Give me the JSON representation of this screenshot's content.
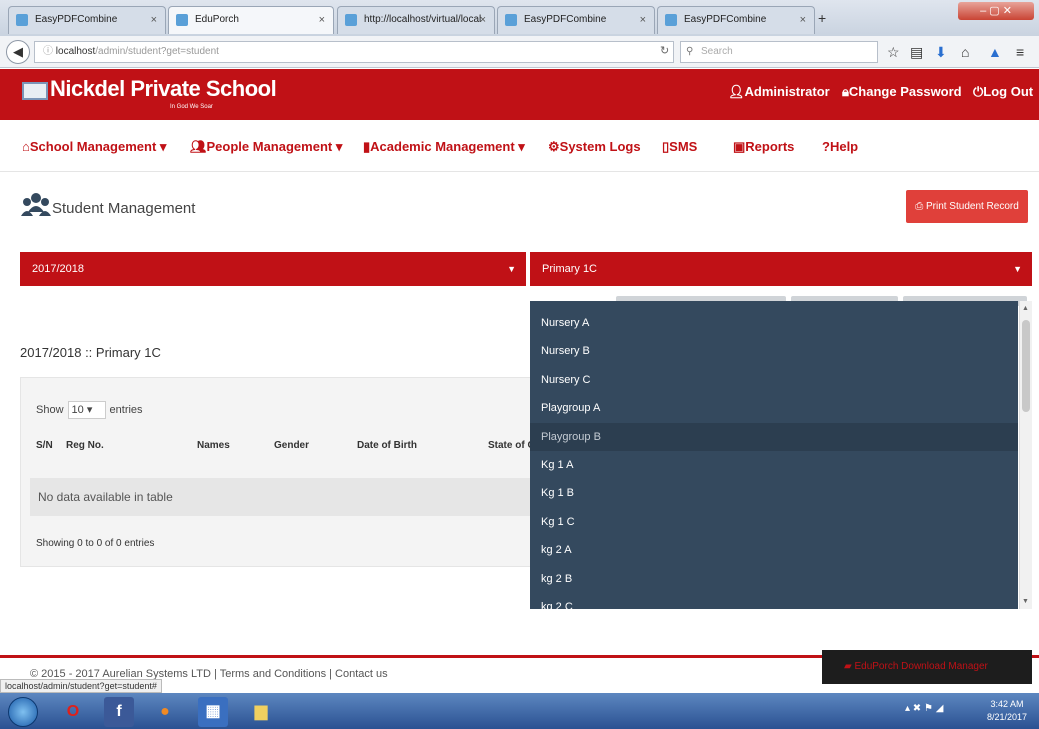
{
  "browser": {
    "tabs": [
      {
        "label": "EasyPDFCombine",
        "active": false
      },
      {
        "label": "EduPorch",
        "active": true
      },
      {
        "label": "http://localhost/virtual/local",
        "active": false
      },
      {
        "label": "EasyPDFCombine",
        "active": false
      },
      {
        "label": "EasyPDFCombine",
        "active": false
      }
    ],
    "new_tab_symbol": "+",
    "url_host": "localhost",
    "url_path": "/admin/student?get=student",
    "search_placeholder": "Search"
  },
  "header": {
    "school_name": "Nickdel Private School",
    "motto": "In God We Soar",
    "links": {
      "admin": "Administrator",
      "change_password": "Change Password",
      "logout": "Log Out"
    }
  },
  "menu": {
    "school_management": "School Management",
    "people_management": "People Management",
    "academic_management": "Academic Management",
    "system_logs": "System Logs",
    "sms": "SMS",
    "reports": "Reports",
    "help": "Help"
  },
  "page": {
    "title": "Student Management",
    "print_button": "Print Student Record",
    "session_select": "2017/2018",
    "class_select": "Primary 1C",
    "section_title": "2017/2018 :: Primary 1C"
  },
  "table": {
    "show_label": "Show",
    "page_length": "10",
    "entries_label": "entries",
    "columns": [
      "S/N",
      "Reg No.",
      "Names",
      "Gender",
      "Date of Birth",
      "State of O"
    ],
    "empty_text": "No data available in table",
    "info_text": "Showing 0 to 0 of 0 entries"
  },
  "dropdown": {
    "options": [
      "Nursery A",
      "Nursery B",
      "Nursery C",
      "Playgroup A",
      "Playgroup B",
      "Kg 1 A",
      "Kg 1 B",
      "Kg 1 C",
      "kg 2 A",
      "kg 2 B",
      "kg 2 C"
    ],
    "hovered_option": "Playgroup B"
  },
  "footer": {
    "text": "© 2015 - 2017 Aurelian Systems LTD | Terms and Conditions | Contact us",
    "status_url": "localhost/admin/student?get=student#",
    "download_manager": "EduPorch Download Manager"
  },
  "taskbar": {
    "time": "3:42 AM",
    "date": "8/21/2017"
  },
  "colors": {
    "brand_red": "#c01116",
    "dropdown_bg": "#34495e",
    "print_btn": "#e0403a"
  }
}
